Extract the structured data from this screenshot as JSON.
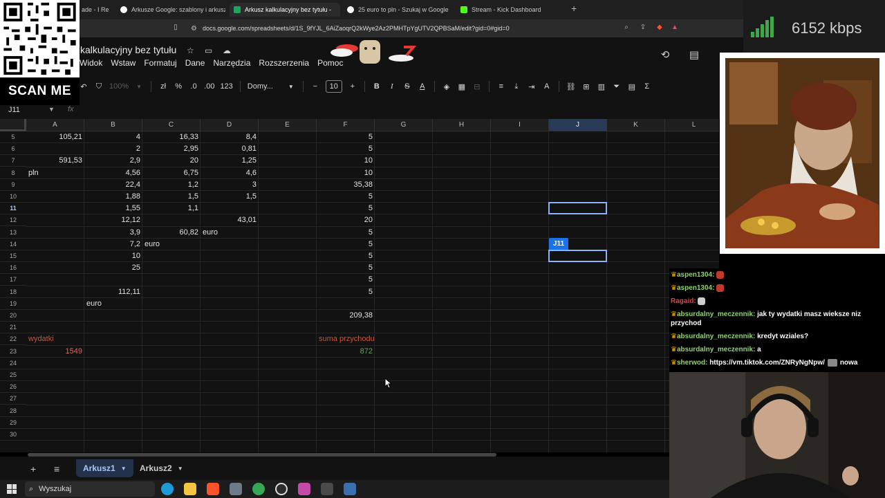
{
  "browser": {
    "tabs": [
      {
        "label": "ade - I Re",
        "active": false
      },
      {
        "label": "Arkusze Google: szablony i arkusze i",
        "active": false
      },
      {
        "label": "Arkusz kalkulacyjny bez tytułu -",
        "active": true
      },
      {
        "label": "25 euro to pln - Szukaj w Google",
        "active": false
      },
      {
        "label": "Stream - Kick Dashboard",
        "active": false
      }
    ],
    "url": "docs.google.com/spreadsheets/d/1S_9fYJL_6AiZaoqrQ2kWye2Az2PMHTpYgUTV2QPBSaM/edit?gid=0#gid=0"
  },
  "sheets": {
    "title": "kalkulacyjny bez tytułu",
    "menu": [
      "Widok",
      "Wstaw",
      "Formatuj",
      "Dane",
      "Narzędzia",
      "Rozszerzenia",
      "Pomoc"
    ],
    "toolbar": {
      "zoom": "100%",
      "currency": "zł",
      "percent": "%",
      "dec_decrease": ".0",
      "dec_increase": ".00",
      "number_format": "123",
      "font": "Domy...",
      "font_size": "10"
    },
    "name_box": "J11",
    "fx": "fx",
    "columns": [
      "A",
      "B",
      "C",
      "D",
      "E",
      "F",
      "G",
      "H",
      "I",
      "J",
      "K",
      "L"
    ],
    "selected_column": "J",
    "rows": [
      5,
      6,
      7,
      8,
      9,
      10,
      11,
      12,
      13,
      14,
      15,
      16,
      17,
      18,
      19,
      20,
      21,
      22,
      23,
      24,
      25,
      26,
      27,
      28,
      29,
      30
    ],
    "selected_row": 11,
    "cells": {
      "A5": "105,21",
      "B5": "4",
      "C5": "16,33",
      "D5": "8,4",
      "F5": "5",
      "B6": "2",
      "C6": "2,95",
      "D6": "0,81",
      "F6": "5",
      "A7": "591,53",
      "B7": "2,9",
      "C7": "20",
      "D7": "1,25",
      "F7": "10",
      "A8": "pln",
      "B8": "4,56",
      "C8": "6,75",
      "D8": "4,6",
      "F8": "10",
      "B9": "22,4",
      "C9": "1,2",
      "D9": "3",
      "F9": "35,38",
      "B10": "1,88",
      "C10": "1,5",
      "D10": "1,5",
      "F10": "5",
      "B11": "1,55",
      "C11": "1,1",
      "F11": "5",
      "B12": "12,12",
      "D12": "43,01",
      "F12": "20",
      "B13": "3,9",
      "C13": "60,82",
      "D13": "euro",
      "F13": "5",
      "B14": "7,2",
      "C14": "euro",
      "F14": "5",
      "B15": "10",
      "F15": "5",
      "B16": "25",
      "F16": "5",
      "F17": "5",
      "B18": "112,11",
      "F18": "5",
      "B19": "euro",
      "F20": "209,38",
      "A22": "wydatki",
      "F22": "suma przychodu",
      "A23": "1549",
      "F23": "872"
    },
    "col_tag": "J11",
    "sheet_tabs": [
      {
        "label": "Arkusz1",
        "active": true
      },
      {
        "label": "Arkusz2",
        "active": false
      }
    ]
  },
  "taskbar": {
    "search_placeholder": "Wyszukaj"
  },
  "overlay": {
    "scan_label": "SCAN ME",
    "bitrate": "6152 kbps",
    "chat": [
      {
        "user": "aspen1304",
        "text": "",
        "color": "#8fd36b",
        "crown": true
      },
      {
        "user": "aspen1304",
        "text": "",
        "color": "#8fd36b",
        "crown": true
      },
      {
        "user": "Ragaid",
        "text": "",
        "color": "#e0403a",
        "crown": false
      },
      {
        "user": "absurdalny_meczennik",
        "text": "jak ty wydatki masz wieksze niz przychod",
        "color": "#8fd36b",
        "crown": true
      },
      {
        "user": "absurdalny_meczennik",
        "text": "kredyt wziales?",
        "color": "#8fd36b",
        "crown": true
      },
      {
        "user": "absurdalny_meczennik",
        "text": "a",
        "color": "#8fd36b",
        "crown": true
      },
      {
        "user": "sherwod",
        "text": "https://vm.tiktok.com/ZNRyNgNpw/",
        "extra": "nowa",
        "color": "#8fd36b",
        "crown": true
      }
    ]
  },
  "colors": {
    "accent": "#1a73e8",
    "selection": "#8ab4f8",
    "expense_red": "#e06666",
    "income_green": "#5fa85f",
    "label_orange": "#c7563b"
  }
}
